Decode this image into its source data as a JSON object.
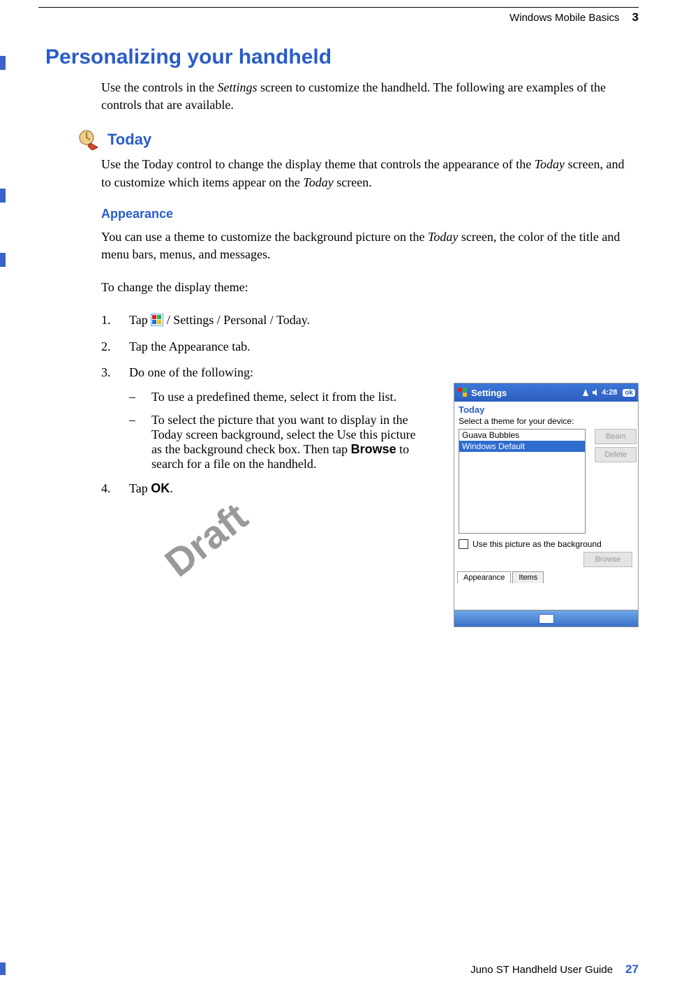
{
  "header": {
    "chapter_title": "Windows Mobile Basics",
    "chapter_number": "3"
  },
  "section": {
    "title": "Personalizing your handheld",
    "intro_a": "Use the controls in the ",
    "intro_em1": "Settings",
    "intro_b": " screen to customize the handheld. The following are examples of the controls that are available."
  },
  "today": {
    "heading": "Today",
    "para_a": "Use the Today control to change the display theme that controls the appearance of the ",
    "para_em1": "Today",
    "para_b": " screen, and to customize which items appear on the ",
    "para_em2": "Today",
    "para_c": " screen."
  },
  "appearance": {
    "heading": "Appearance",
    "para_a": "You can use a theme to customize the background picture on the ",
    "para_em1": "Today",
    "para_b": " screen, the color of the title and menu bars, menus, and messages.",
    "lead": "To change the display theme:",
    "steps": {
      "s1_num": "1.",
      "s1_a": "Tap ",
      "s1_b": " / ",
      "s1_em1": "Settings",
      "s1_c": " / ",
      "s1_em2": "Personal",
      "s1_d": " / ",
      "s1_em3": "Today",
      "s1_e": ".",
      "s2_num": "2.",
      "s2_a": "Tap the ",
      "s2_em1": "Appearance",
      "s2_b": " tab.",
      "s3_num": "3.",
      "s3_a": "Do one of the following:",
      "b1": "To use a predefined theme, select it from the list.",
      "b2_a": "To select the picture that you want to display in the ",
      "b2_em1": "Today",
      "b2_b": " screen background, select the ",
      "b2_em2": "Use this picture as the background",
      "b2_c": " check box. Then tap ",
      "b2_bold": "Browse",
      "b2_d": " to search for a file on the handheld.",
      "s4_num": "4.",
      "s4_a": "Tap ",
      "s4_bold": "OK",
      "s4_b": "."
    }
  },
  "watermark": "Draft",
  "footer": {
    "book": "Juno ST Handheld User Guide",
    "page": "27"
  },
  "device": {
    "title": "Settings",
    "time": "4:28",
    "ok": "ok",
    "screen_title": "Today",
    "prompt": "Select a theme for your device:",
    "themes": [
      "Guava Bubbles",
      "Windows Default"
    ],
    "btn_beam": "Beam",
    "btn_delete": "Delete",
    "chk_label": "Use this picture as the background",
    "btn_browse": "Browse",
    "tab_appearance": "Appearance",
    "tab_items": "Items"
  }
}
